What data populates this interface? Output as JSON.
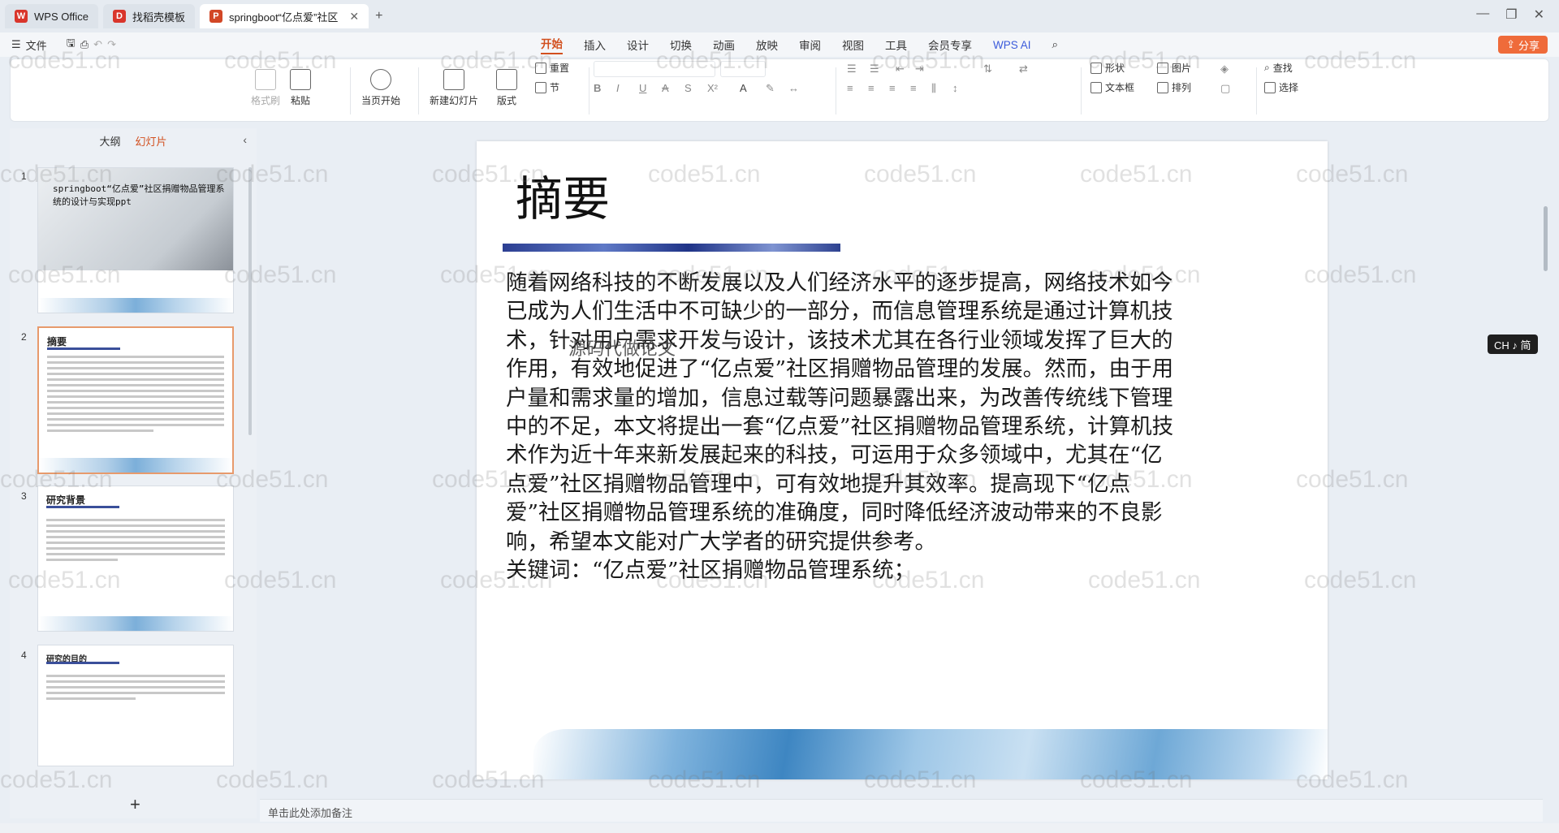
{
  "titlebar": {
    "tabs": [
      {
        "label": "WPS Office",
        "icon": "wps-logo-icon",
        "color": "#d9352b"
      },
      {
        "label": "找稻壳模板",
        "icon": "docer-logo-icon",
        "color": "#d9352b"
      },
      {
        "label": "springboot“亿点爱”社区",
        "icon": "ppt-logo-icon",
        "color": "#d24726"
      }
    ],
    "new_tab": "+"
  },
  "menubar": {
    "file_label": "文件",
    "tabs": [
      "开始",
      "插入",
      "设计",
      "切换",
      "动画",
      "放映",
      "审阅",
      "视图",
      "工具",
      "会员专享"
    ],
    "active_tab": "开始",
    "wps_ai": "WPS AI",
    "share_label": "分享"
  },
  "ribbon": {
    "format_painter": "格式刷",
    "paste": "粘贴",
    "play_from_current": "当页开始",
    "new_slide": "新建幻灯片",
    "layout": "版式",
    "reset": "重置",
    "section": "节",
    "shape": "形状",
    "picture": "图片",
    "textbox": "文本框",
    "arrange": "排列",
    "find": "查找",
    "select": "选择"
  },
  "leftpane": {
    "tabs": [
      "大纲",
      "幻灯片"
    ],
    "active_tab": "幻灯片",
    "slides": [
      {
        "num": "1",
        "title": "springboot“亿点爱”社区捐赠物品管理系统的设计与实现ppt"
      },
      {
        "num": "2",
        "title": "摘要"
      },
      {
        "num": "3",
        "title": "研究背景"
      },
      {
        "num": "4",
        "title": "研究的目的"
      }
    ],
    "add_slide": "+"
  },
  "slide": {
    "title": "摘要",
    "body": "随着网络科技的不断发展以及人们经济水平的逐步提高，网络技术如今已成为人们生活中不可缺少的一部分，而信息管理系统是通过计算机技术，针对用户需求开发与设计，该技术尤其在各行业领域发挥了巨大的作用，有效地促进了“亿点爱”社区捐赠物品管理的发展。然而，由于用户量和需求量的增加，信息过载等问题暴露出来，为改善传统线下管理中的不足，本文将提出一套“亿点爱”社区捐赠物品管理系统，计算机技术作为近十年来新发展起来的科技，可运用于众多领域中，尤其在“亿点爱”社区捐赠物品管理中，可有效地提升其效率。提高现下“亿点爱”社区捐赠物品管理系统的准确度，同时降低经济波动带来的不良影响，希望本文能对广大学者的研究提供参考。",
    "keywords": "关键词：“亿点爱”社区捐赠物品管理系统；",
    "overlay_caption": "源码代做论文"
  },
  "ime_badge": "CH ♪ 简",
  "notes_placeholder": "单击此处添加备注",
  "watermark": "code51.cn"
}
